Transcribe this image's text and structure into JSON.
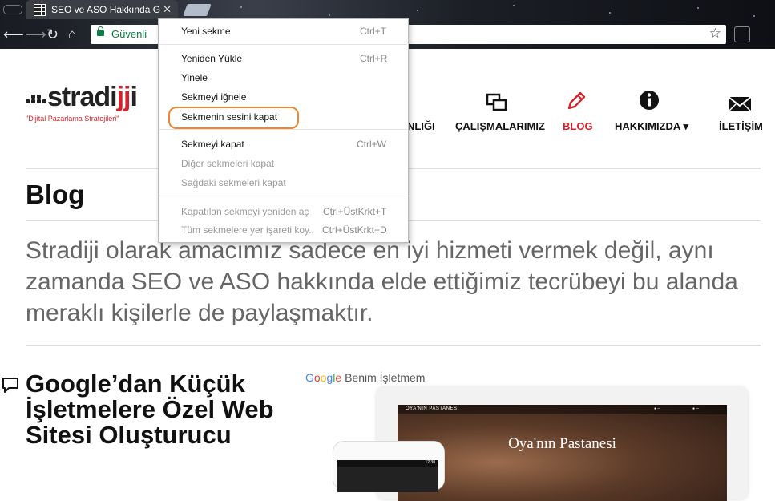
{
  "browser": {
    "tab_title": "SEO ve ASO Hakkında G",
    "tab_close": "✕",
    "secure_label": "Güvenli"
  },
  "site": {
    "logo_main": "stradi",
    "logo_accent": "jj",
    "logo_tail": "i",
    "logo_tagline": "\"Dijital Pazarlama Stratejileri\"",
    "nav": [
      {
        "label": "NLIĞI"
      },
      {
        "label": "ÇALIŞMALARIMIZ"
      },
      {
        "label": "BLOG"
      },
      {
        "label": "HAKKIMIZDA ▾"
      },
      {
        "label": "İLETİŞİM"
      }
    ],
    "page_title": "Blog",
    "intro": "Stradiji olarak amacımız sadece en iyi hizmeti vermek değil, aynı zamanda SEO ve ASO hakkında elde ettiğimiz tecrübeyi bu alanda meraklı kişilerle de paylaşmaktır.",
    "post_title": "Google’dan Küçük İşletmelere Özel Web Sitesi Oluşturucu",
    "image_caption_rest": " Benim İşletmem",
    "mock_brand": "OYA'NIN PASTANESI",
    "mock_title": "Oya'nın Pastanesi",
    "mock_phone_time": "12:30"
  },
  "context_menu": {
    "items": [
      {
        "label": "Yeni sekme",
        "shortcut": "Ctrl+T",
        "disabled": false
      },
      {
        "label": "Yeniden Yükle",
        "shortcut": "Ctrl+R",
        "disabled": false
      },
      {
        "label": "Yinele",
        "shortcut": "",
        "disabled": false
      },
      {
        "label": "Sekmeyi iğnele",
        "shortcut": "",
        "disabled": false
      },
      {
        "label": "Sekmenin sesini kapat",
        "shortcut": "",
        "disabled": false
      },
      {
        "label": "Sekmeyi kapat",
        "shortcut": "Ctrl+W",
        "disabled": false
      },
      {
        "label": "Diğer sekmeleri kapat",
        "shortcut": "",
        "disabled": true
      },
      {
        "label": "Sağdaki sekmeleri kapat",
        "shortcut": "",
        "disabled": true
      },
      {
        "label": "Kapatılan sekmeyi yeniden aç",
        "shortcut": "Ctrl+ÜstKrkt+T",
        "disabled": true
      },
      {
        "label": "Tüm sekmelere yer işareti koy...",
        "shortcut": "Ctrl+ÜstKrkt+D",
        "disabled": true
      }
    ]
  },
  "colors": {
    "brand_red": "#d32029",
    "highlight_orange": "#f0862c",
    "secure_green": "#0b8043"
  }
}
